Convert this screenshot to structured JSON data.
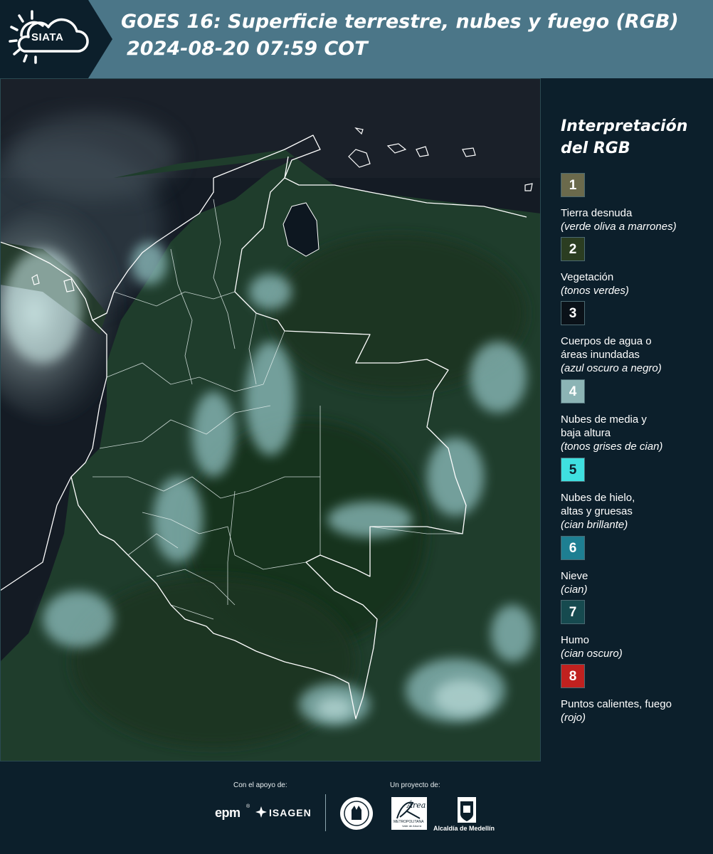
{
  "header": {
    "logo_text": "SIATA",
    "title_line1": "GOES 16: Superficie terrestre, nubes y fuego (RGB)",
    "title_line2": "2024-08-20 07:59 COT",
    "colors": {
      "band": "#4b7688",
      "logo_bg": "#0c1f2b"
    }
  },
  "map": {
    "image": "satellite-composite",
    "colors": {
      "vegetation": "#22402f",
      "water": "#10161f",
      "cloud_low": "#7fb5b6"
    }
  },
  "legend": {
    "title": "Interpretación del RGB",
    "items": [
      {
        "number": "1",
        "label": "Tierra desnuda",
        "desc": "(verde oliva a marrones)",
        "color": "#6b6a4c",
        "text_color": "#ffffff"
      },
      {
        "number": "2",
        "label": "Vegetación",
        "desc": "(tonos verdes)",
        "color": "#2b3d21",
        "text_color": "#ffffff"
      },
      {
        "number": "3",
        "label": "Cuerpos de agua o áreas inundadas",
        "desc": "(azul oscuro a negro)",
        "color": "#0a1118",
        "text_color": "#ffffff"
      },
      {
        "number": "4",
        "label": "Nubes de media y baja altura",
        "desc": "(tonos grises de cian)",
        "color": "#8cb4b5",
        "text_color": "#ffffff"
      },
      {
        "number": "5",
        "label": "Nubes de hielo, altas y gruesas",
        "desc": "(cian brillante)",
        "color": "#3fe0e0",
        "text_color": "#0c1f2b"
      },
      {
        "number": "6",
        "label": "Nieve",
        "desc": "(cian)",
        "color": "#1e7f92",
        "text_color": "#ffffff"
      },
      {
        "number": "7",
        "label": "Humo",
        "desc": "(cian oscuro)",
        "color": "#164a4f",
        "text_color": "#ffffff"
      },
      {
        "number": "8",
        "label": "Puntos calientes, fuego",
        "desc": "(rojo)",
        "color": "#c0211f",
        "text_color": "#ffffff"
      }
    ]
  },
  "footer": {
    "support_label": "Con el apoyo de:",
    "project_label": "Un proyecto de:",
    "sponsors": {
      "epm": "epm",
      "isagen": "ISAGEN"
    },
    "partners": {
      "metro_name": "Área",
      "metro_sub": "METROPOLITANA",
      "metro_sub2": "Valle de Aburrá",
      "alcaldia": "Alcaldía de Medellín"
    },
    "icons": [
      "sun-icon",
      "cloud-icon",
      "seal-icon",
      "coat-of-arms-icon"
    ]
  }
}
